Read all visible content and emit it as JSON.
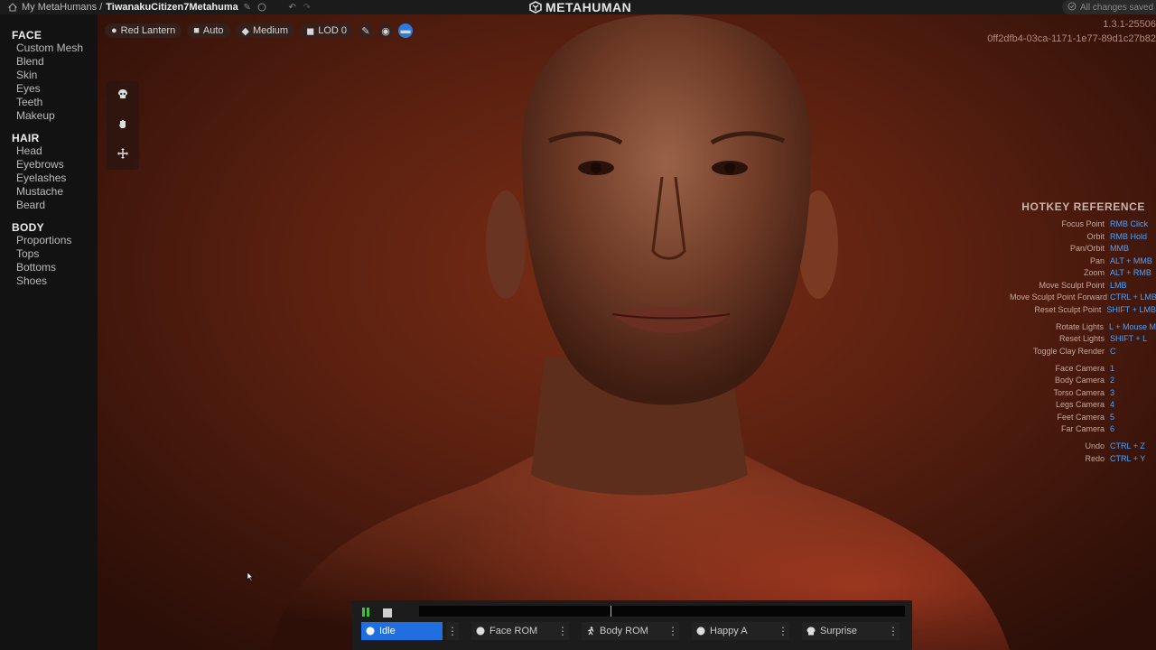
{
  "topbar": {
    "crumb_root": "My MetaHumans /",
    "crumb_current": "TiwanakuCitizen7Metahuma",
    "logo_text": "METAHUMAN",
    "saved_status": "All changes saved"
  },
  "sidebar": {
    "sections": [
      {
        "title": "FACE",
        "items": [
          "Custom Mesh",
          "Blend",
          "Skin",
          "Eyes",
          "Teeth",
          "Makeup"
        ]
      },
      {
        "title": "HAIR",
        "items": [
          "Head",
          "Eyebrows",
          "Eyelashes",
          "Mustache",
          "Beard"
        ]
      },
      {
        "title": "BODY",
        "items": [
          "Proportions",
          "Tops",
          "Bottoms",
          "Shoes"
        ]
      }
    ]
  },
  "viewport": {
    "chips": {
      "lighting": "Red Lantern",
      "camera": "Auto",
      "quality": "Medium",
      "lod": "LOD 0"
    },
    "version": "1.3.1-25506",
    "build_id": "0ff2dfb4-03ca-1171-1e77-89d1c27b82"
  },
  "hotkeys": {
    "title": "HOTKEY REFERENCE",
    "groups": [
      [
        {
          "action": "Focus Point",
          "key": "RMB Click"
        },
        {
          "action": "Orbit",
          "key": "RMB Hold"
        },
        {
          "action": "Pan/Orbit",
          "key": "MMB"
        },
        {
          "action": "Pan",
          "key": "ALT + MMB"
        },
        {
          "action": "Zoom",
          "key": "ALT + RMB"
        },
        {
          "action": "Move Sculpt Point",
          "key": "LMB"
        },
        {
          "action": "Move Sculpt Point Forward",
          "key": "CTRL + LMB"
        },
        {
          "action": "Reset Sculpt Point",
          "key": "SHIFT + LMB"
        }
      ],
      [
        {
          "action": "Rotate Lights",
          "key": "L + Mouse M"
        },
        {
          "action": "Reset Lights",
          "key": "SHIFT + L"
        },
        {
          "action": "Toggle Clay Render",
          "key": "C"
        }
      ],
      [
        {
          "action": "Face Camera",
          "key": "1"
        },
        {
          "action": "Body Camera",
          "key": "2"
        },
        {
          "action": "Torso Camera",
          "key": "3"
        },
        {
          "action": "Legs Camera",
          "key": "4"
        },
        {
          "action": "Feet Camera",
          "key": "5"
        },
        {
          "action": "Far Camera",
          "key": "6"
        }
      ],
      [
        {
          "action": "Undo",
          "key": "CTRL + Z"
        },
        {
          "action": "Redo",
          "key": "CTRL + Y"
        }
      ]
    ]
  },
  "timeline": {
    "animations": [
      "Idle",
      "Face ROM",
      "Body ROM",
      "Happy A",
      "Surprise"
    ],
    "active": "Idle"
  },
  "colors": {
    "accent": "#1f6fe0",
    "hotkey_key": "#4aa3ff",
    "background_red": "#6a2612"
  }
}
